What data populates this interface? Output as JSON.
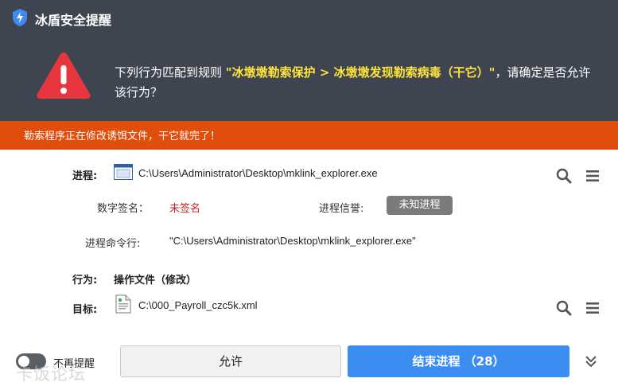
{
  "window": {
    "title": "冰盾安全提醒"
  },
  "alert": {
    "message_prefix": "下列行为匹配到规则 ",
    "rule_highlight": "\"冰墩墩勒索保护 > 冰墩墩发现勒索病毒（干它）\"",
    "message_suffix": "，请确定是否允许该行为？"
  },
  "banner": {
    "text": "勒索程序正在修改诱饵文件，干它就完了！"
  },
  "process": {
    "label": "进程:",
    "path": "C:\\Users\\Administrator\\Desktop\\mklink_explorer.exe",
    "signature_label": "数字签名：",
    "signature_value": "未签名",
    "reputation_label": "进程信誉:",
    "reputation_badge": "未知进程",
    "cmdline_label": "进程命令行:",
    "cmdline_value": "\"C:\\Users\\Administrator\\Desktop\\mklink_explorer.exe\""
  },
  "behavior": {
    "label": "行为:",
    "value": "操作文件（修改）"
  },
  "target": {
    "label": "目标:",
    "path": "C:\\000_Payroll_czc5k.xml"
  },
  "footer": {
    "dont_remind_label": "不再提醒",
    "dont_remind_on": false,
    "allow_button": "允许",
    "end_process_button": "结束进程 （28）",
    "watermark": "卡饭论坛"
  },
  "colors": {
    "header_bg": "#3e4550",
    "banner_bg": "#e04e0e",
    "highlight": "#ffe43a",
    "warning": "#e8363f",
    "primary_button": "#3b8ef0",
    "unsigned_text": "#cc2222"
  },
  "icons": [
    "shield-icon",
    "warning-triangle-icon",
    "exe-file-icon",
    "search-icon",
    "menu-icon",
    "document-icon",
    "chevron-double-down-icon"
  ]
}
